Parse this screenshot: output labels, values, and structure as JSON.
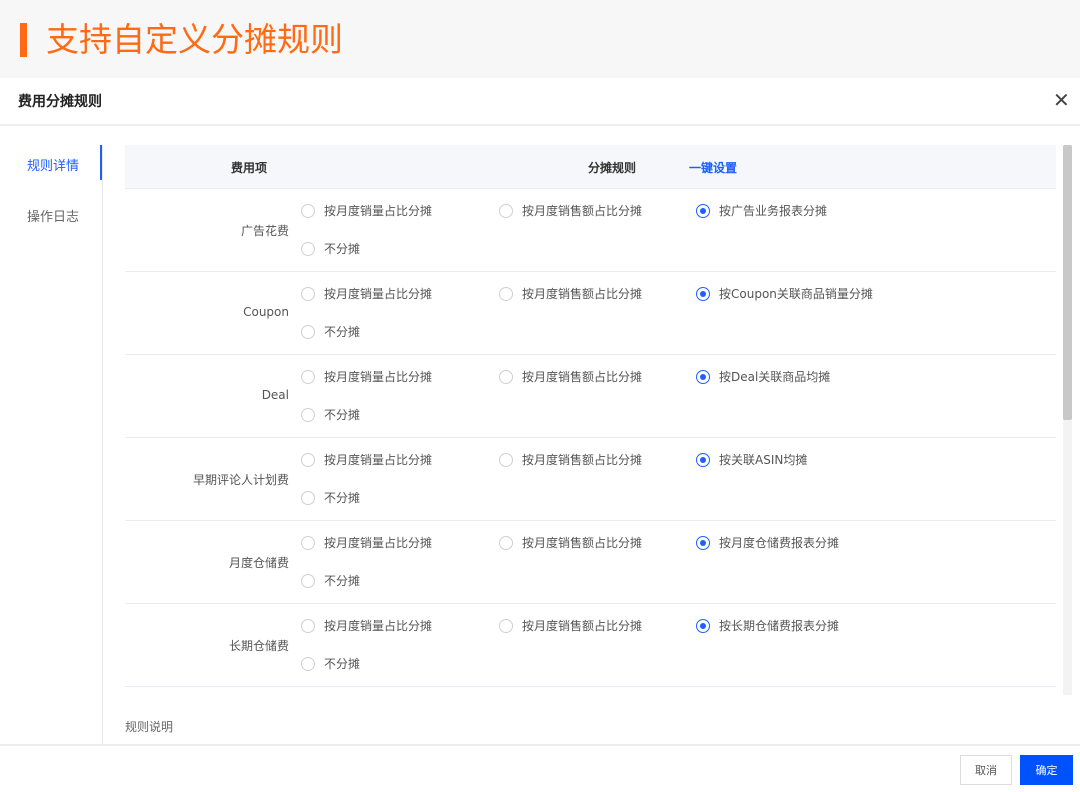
{
  "banner": {
    "title": "支持自定义分摊规则"
  },
  "dialog": {
    "title": "费用分摊规则"
  },
  "nav": {
    "items": [
      "规则详情",
      "操作日志"
    ]
  },
  "table": {
    "headers": {
      "item": "费用项",
      "rule": "分摊规则",
      "quick_set": "一键设置"
    },
    "common_options": {
      "by_volume": "按月度销量占比分摊",
      "by_amount": "按月度销售额占比分摊",
      "none": "不分摊"
    },
    "rows": [
      {
        "label": "广告花费",
        "special": "按广告业务报表分摊",
        "selected": "special"
      },
      {
        "label": "Coupon",
        "special": "按Coupon关联商品销量分摊",
        "selected": "special"
      },
      {
        "label": "Deal",
        "special": "按Deal关联商品均摊",
        "selected": "special"
      },
      {
        "label": "早期评论人计划费",
        "special": "按关联ASIN均摊",
        "selected": "special"
      },
      {
        "label": "月度仓储费",
        "special": "按月度仓储费报表分摊",
        "selected": "special"
      },
      {
        "label": "长期仓储费",
        "special": "按长期仓储费报表分摊",
        "selected": "special"
      }
    ]
  },
  "note": "规则说明",
  "footer": {
    "cancel": "取消",
    "ok": "确定"
  }
}
